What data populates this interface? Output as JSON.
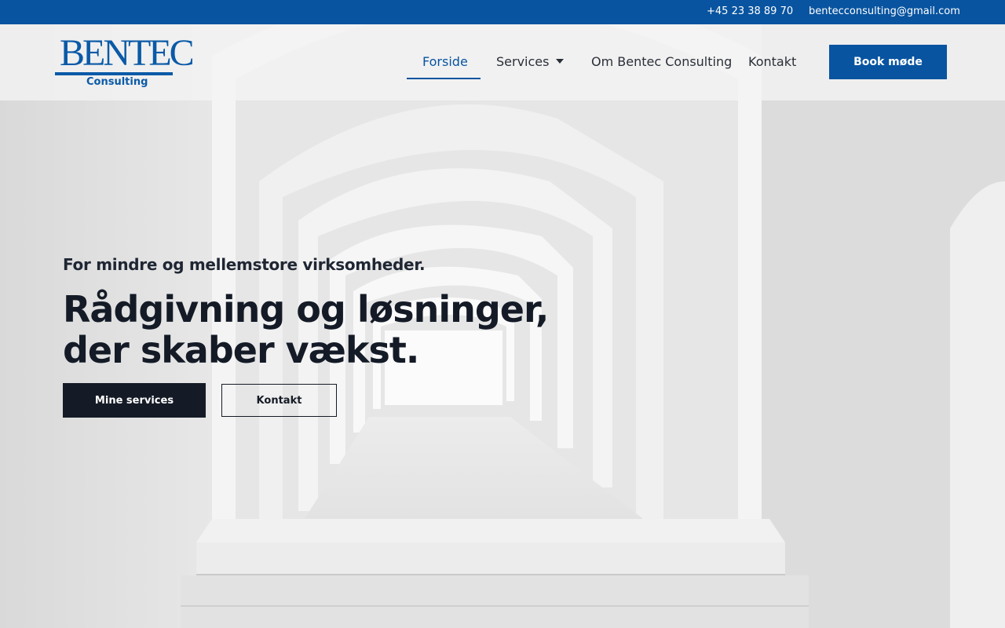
{
  "topbar": {
    "phone": "+45 23 38 89 70",
    "email": "bentecconsulting@gmail.com"
  },
  "logo": {
    "word": "BENTEC",
    "sub": "Consulting"
  },
  "nav": {
    "items": [
      {
        "label": "Forside",
        "active": true
      },
      {
        "label": "Services",
        "has_dropdown": true
      },
      {
        "label": "Om Bentec Consulting"
      },
      {
        "label": "Kontakt"
      }
    ],
    "cta_label": "Book møde"
  },
  "hero": {
    "eyebrow": "For mindre og mellemstore virksomheder.",
    "title_line1": "Rådgivning og løsninger,",
    "title_line2": "der skaber vækst.",
    "primary_button": "Mine services",
    "secondary_button": "Kontakt"
  },
  "colors": {
    "brand_blue": "#0854a0",
    "dark": "#151b26",
    "hero_bg": "#e9e9e9"
  },
  "icons": {
    "dropdown": "chevron-down-icon"
  }
}
